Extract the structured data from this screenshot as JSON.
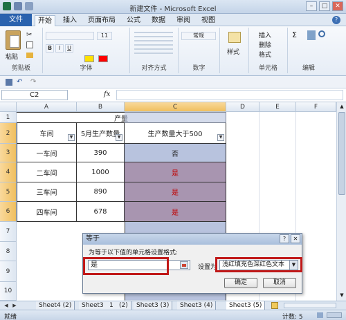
{
  "window": {
    "title": "新建文件  -  Microsoft Excel"
  },
  "ribbon": {
    "file_tab": "文件",
    "tabs": [
      "开始",
      "插入",
      "页面布局",
      "公式",
      "数据",
      "审阅",
      "视图"
    ],
    "groups": {
      "clipboard": "剪贴板",
      "font": "字体",
      "alignment": "对齐方式",
      "number": "数字",
      "style_button": "样式",
      "cells": "单元格",
      "editing": "编辑",
      "paste_label": "粘贴",
      "font_size": "11",
      "number_format": "常规",
      "insert": "插入",
      "delete": "删除",
      "format": "格式"
    }
  },
  "formula_bar": {
    "name_box": "C2",
    "fx": "fx"
  },
  "grid": {
    "columns": [
      "A",
      "B",
      "C",
      "D",
      "E",
      "F"
    ],
    "rows": [
      "1",
      "2",
      "3",
      "4",
      "5",
      "6",
      "7",
      "8",
      "9",
      "10"
    ],
    "merged_title": "产量",
    "headers": {
      "a": "车间",
      "b": "5月生产数量",
      "c": "生产数量大于500"
    },
    "data_rows": [
      {
        "a": "一车间",
        "b": "390",
        "c": "否"
      },
      {
        "a": "二车间",
        "b": "1000",
        "c": "是"
      },
      {
        "a": "三车间",
        "b": "890",
        "c": "是"
      },
      {
        "a": "四车间",
        "b": "678",
        "c": "是"
      }
    ]
  },
  "sheet_tabs": [
    "Sheet4 (2)",
    "Sheet3",
    "1",
    "(2)",
    "Sheet3 (3)",
    "Sheet3 (4)",
    "Sheet3 (5)"
  ],
  "status_bar": {
    "mode": "就绪",
    "count": "计数: 5"
  },
  "dialog": {
    "title": "等于",
    "prompt": "为等于以下值的单元格设置格式:",
    "value": "是",
    "set_as_label": "设置为",
    "format_option": "浅红填充色深红色文本",
    "ok_label": "确定",
    "cancel_label": "取消"
  }
}
